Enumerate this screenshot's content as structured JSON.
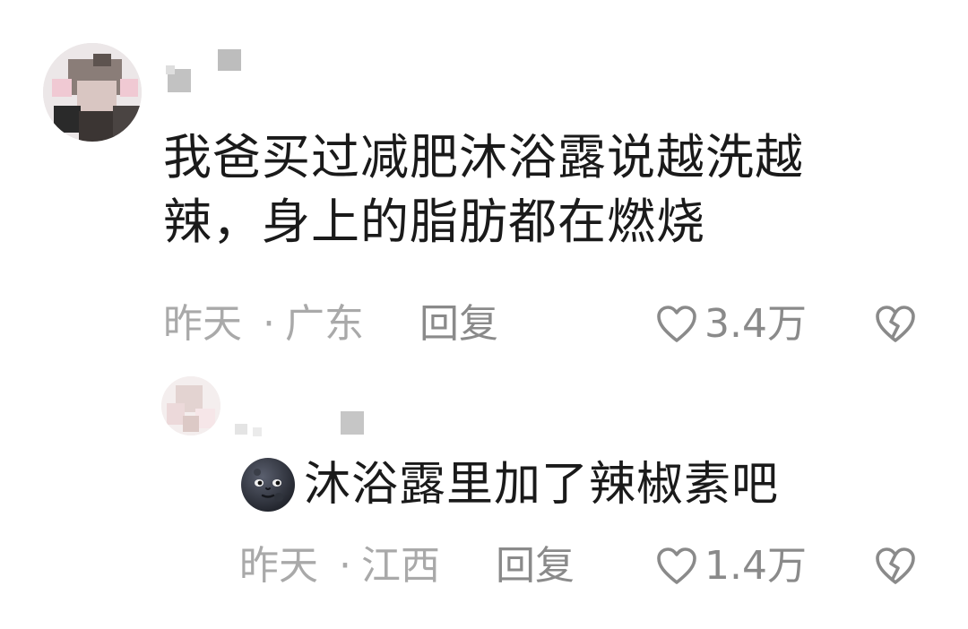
{
  "main_comment": {
    "username": "",
    "text_line1": "我爸买过减肥沐浴露说越洗越",
    "text_line2": "辣，身上的脂肪都在燃烧",
    "time": "昨天",
    "separator": "·",
    "location": "广东",
    "reply_label": "回复",
    "like_count": "3.4万"
  },
  "reply_comment": {
    "username": "",
    "emoji": "new-moon-face",
    "text": "沐浴露里加了辣椒素吧",
    "time": "昨天",
    "separator": "·",
    "location": "江西",
    "reply_label": "回复",
    "like_count": "1.4万"
  },
  "colors": {
    "text_primary": "#1a1a1a",
    "text_meta": "#a9a9a9",
    "text_action": "#8a8a8a",
    "background": "#ffffff"
  }
}
